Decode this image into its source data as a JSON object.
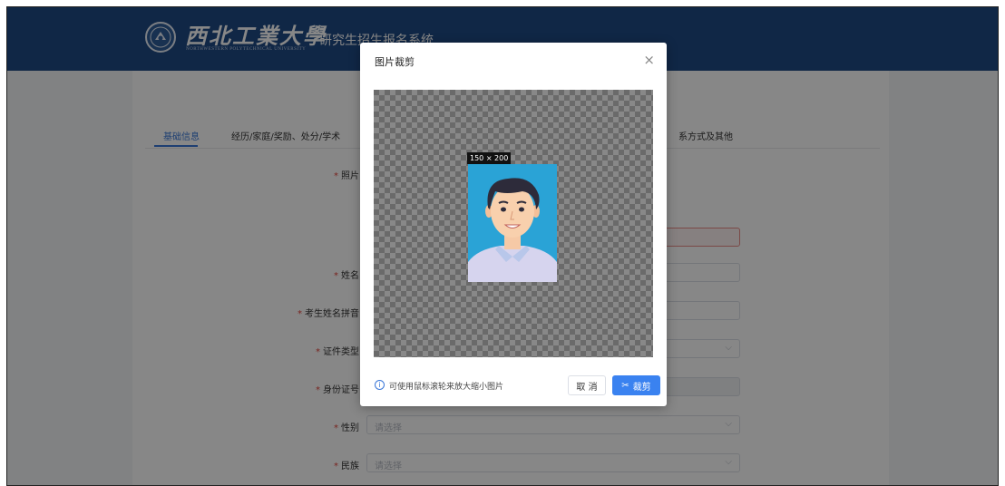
{
  "header": {
    "logo_cn": "西北工業大學",
    "logo_en": "NORTHWESTERN POLYTECHNICAL UNIVERSITY",
    "system_title": "研究生招生报名系统"
  },
  "tabs": {
    "items": [
      "基础信息",
      "经历/家庭/奖励、处分/学术",
      "系方式及其他"
    ],
    "active": "基础信息"
  },
  "form": {
    "labels": {
      "photo": "照片",
      "name": "姓名",
      "pinyin": "考生姓名拼音",
      "id_type": "证件类型",
      "id_number": "身份证号",
      "gender": "性别",
      "ethnicity": "民族"
    },
    "placeholders": {
      "gender": "请选择",
      "ethnicity": "请选择"
    }
  },
  "dialog": {
    "title": "图片裁剪",
    "close_glyph": "×",
    "size_badge": "150 × 200",
    "hint_glyph": "i",
    "hint": "可使用鼠标滚轮来放大缩小图片",
    "cancel_label": "取 消",
    "crop_label": "裁剪",
    "crop_glyph": "✂"
  },
  "colors": {
    "header_bg": "#1f4a85",
    "accent": "#3a82f0",
    "required": "#e2453c",
    "photo_bg": "#2aa3d6"
  }
}
